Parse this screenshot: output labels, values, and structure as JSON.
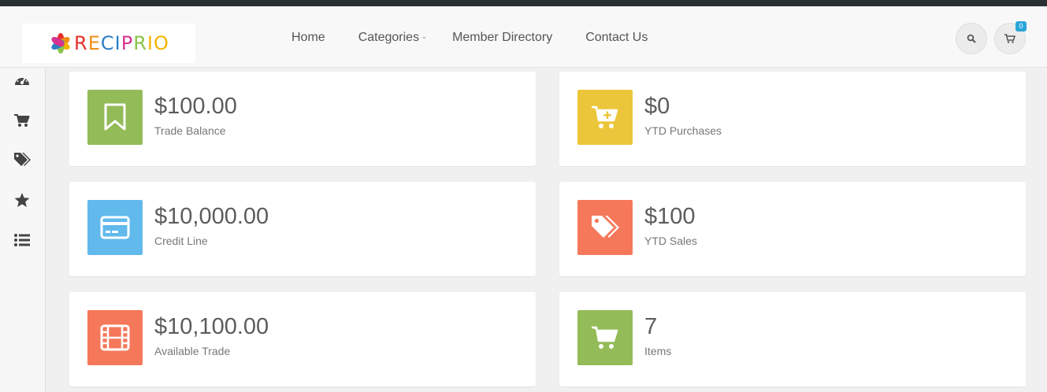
{
  "brand": {
    "letters": [
      "R",
      "E",
      "C",
      "I",
      "P",
      "R",
      "I",
      "O"
    ],
    "letter_colors": [
      "#e5302b",
      "#f08c1a",
      "#2e7fc4",
      "#2e7fc4",
      "#d6328f",
      "#8bc34a",
      "#f4b400",
      "#f4b400"
    ]
  },
  "nav": {
    "items": [
      "Home",
      "Categories",
      "Member Directory",
      "Contact Us"
    ]
  },
  "cart": {
    "count": "0"
  },
  "sidebar": {
    "icons": [
      "dashboard-icon",
      "cart-icon",
      "tags-icon",
      "star-icon",
      "list-icon"
    ]
  },
  "cards": [
    {
      "value": "$100.00",
      "label": "Trade Balance",
      "icon": "bookmark-icon",
      "color": "#93bb58"
    },
    {
      "value": "$0",
      "label": "YTD Purchases",
      "icon": "cart-plus-icon",
      "color": "#ecc63a"
    },
    {
      "value": "$10,000.00",
      "label": "Credit Line",
      "icon": "credit-card-icon",
      "color": "#62b9ec"
    },
    {
      "value": "$100",
      "label": "YTD Sales",
      "icon": "tags-icon",
      "color": "#f5785a"
    },
    {
      "value": "$10,100.00",
      "label": "Available Trade",
      "icon": "film-icon",
      "color": "#f5785a"
    },
    {
      "value": "7",
      "label": "Items",
      "icon": "cart-icon",
      "color": "#93bb58"
    }
  ]
}
